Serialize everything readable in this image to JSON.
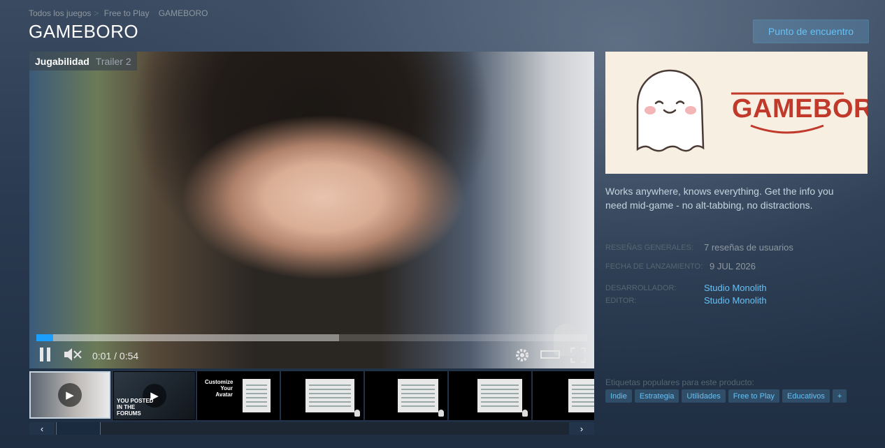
{
  "breadcrumb": [
    "Todos los juegos",
    "Free to Play",
    "GAMEBORO"
  ],
  "page_title": "GAMEBORO",
  "community_hub_button": "Punto de encuentro",
  "player": {
    "tabs": [
      "Jugabilidad",
      "Trailer 2"
    ],
    "time": "0:01 / 0:54",
    "progress_fraction": 0.03,
    "buffered_fraction": 0.55
  },
  "thumbnails": [
    {
      "kind": "video",
      "selected": true
    },
    {
      "kind": "video",
      "caption": "YOU POSTED IN THE FORUMS"
    },
    {
      "kind": "image",
      "caption": "Customize Your Avatar"
    },
    {
      "kind": "image"
    },
    {
      "kind": "image"
    },
    {
      "kind": "image"
    },
    {
      "kind": "image"
    }
  ],
  "capsule": {
    "logo_text": "GAMEBORO"
  },
  "description": "Works anywhere, knows everything. Get the info you need mid-game - no alt-tabbing, no distractions.",
  "details": {
    "reviews_label": "RESEÑAS GENERALES:",
    "reviews_value": "7 reseñas de usuarios",
    "release_label": "FECHA DE LANZAMIENTO:",
    "release_value": "9 JUL 2026",
    "developer_label": "DESARROLLADOR:",
    "developer_value": "Studio Monolith",
    "publisher_label": "EDITOR:",
    "publisher_value": "Studio Monolith"
  },
  "tags_label": "Etiquetas populares para este producto:",
  "tags": [
    "Indie",
    "Estrategia",
    "Utilidades",
    "Free to Play",
    "Educativos",
    "+"
  ],
  "colors": {
    "accent": "#67c1f5",
    "progress": "#1a9fff",
    "brand_red": "#c0392b"
  }
}
